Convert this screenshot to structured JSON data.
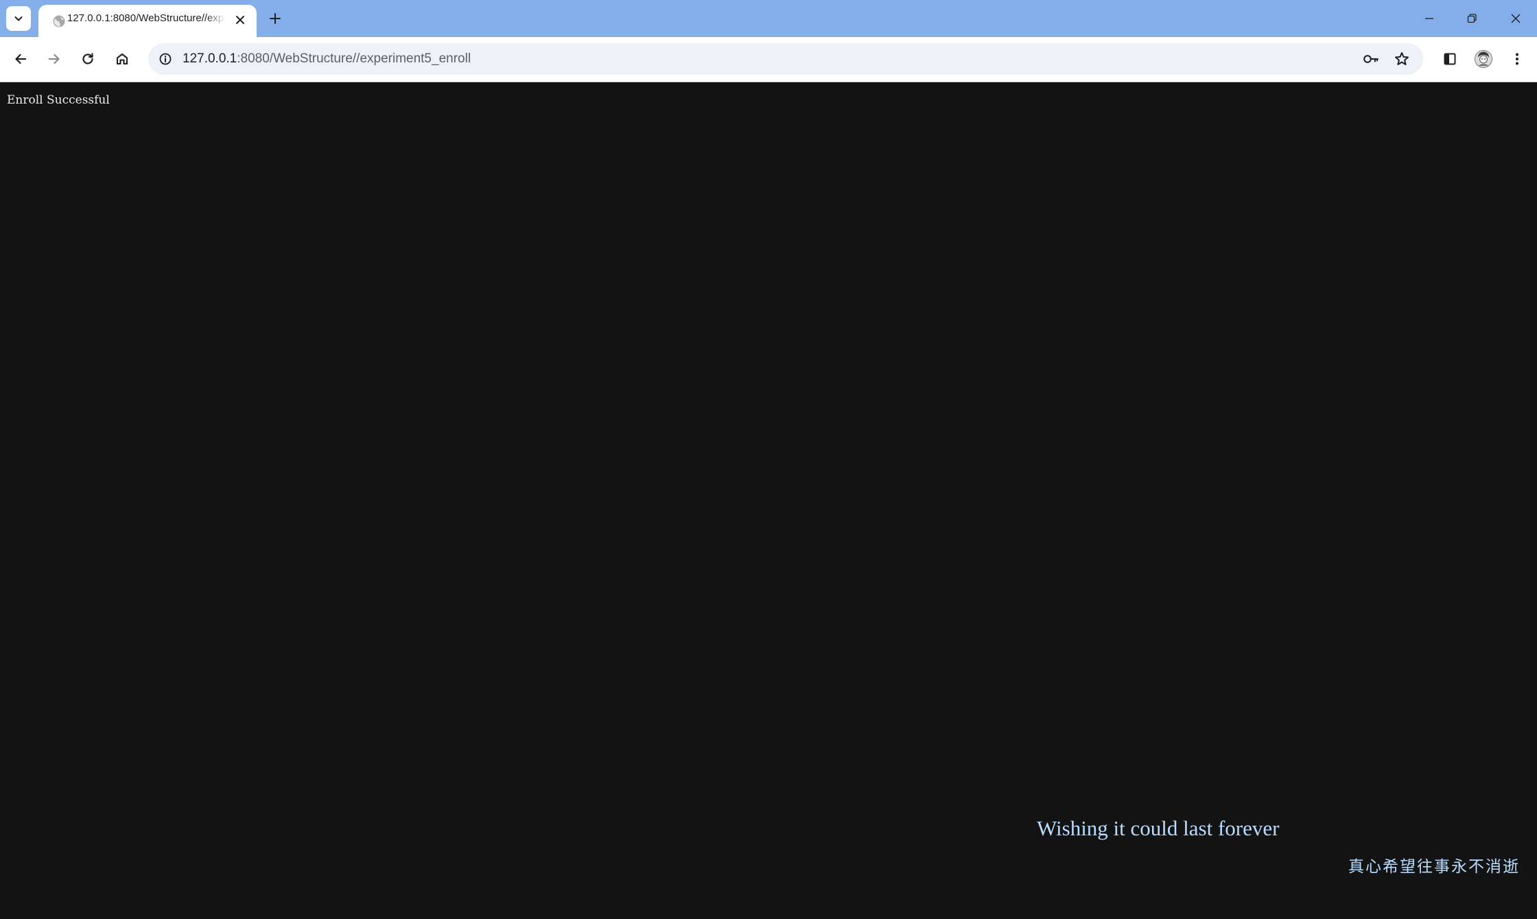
{
  "tabs": [
    {
      "title": "127.0.0.1:8080/WebStructure//experiment5_enroll",
      "active": true,
      "favicon": "globe-icon"
    }
  ],
  "toolbar": {
    "url_host": "127.0.0.1",
    "url_rest": ":8080/WebStructure//experiment5_enroll"
  },
  "page": {
    "message": "Enroll Successful",
    "quote_en": "Wishing it could last forever",
    "quote_zh": "真心希望往事永不消逝"
  },
  "colors": {
    "tabstrip": "#84aeea",
    "page_background": "#131313",
    "message_text": "#f0f0f0",
    "quote_text": "#b9ddff"
  },
  "icons": {
    "tab_search": "chevron-down-icon",
    "new_tab": "plus-icon",
    "back": "arrow-left-icon",
    "forward": "arrow-right-icon",
    "reload": "reload-icon",
    "home": "home-icon",
    "site_info": "info-icon",
    "passwords": "key-icon",
    "bookmark": "star-icon",
    "side_panel": "side-panel-icon",
    "profile": "avatar-icon",
    "menu": "more-vertical-icon"
  }
}
